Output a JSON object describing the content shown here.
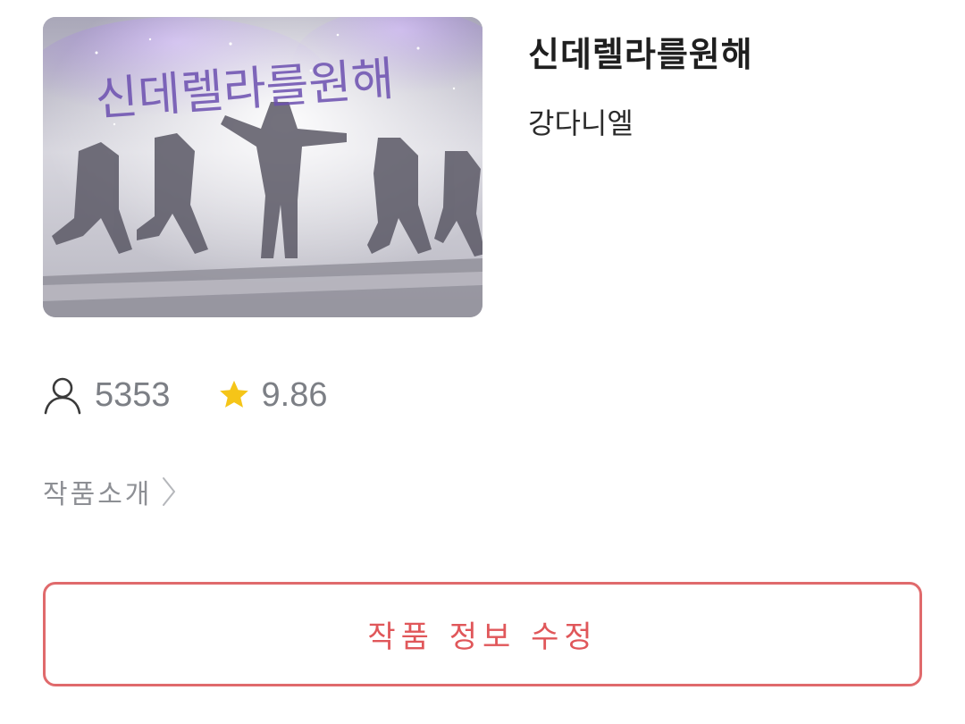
{
  "work": {
    "title": "신데렐라를원해",
    "author": "강다니엘",
    "cover_text": "신데렐라를원해"
  },
  "stats": {
    "views": "5353",
    "rating": "9.86",
    "views_icon": "user-icon",
    "rating_icon": "star-icon"
  },
  "intro": {
    "label": "작품소개",
    "chevron_icon": "chevron-right-icon"
  },
  "actions": {
    "edit_label": "작품 정보 수정"
  },
  "colors": {
    "accent": "#e0575a",
    "star": "#f5c518",
    "muted_text": "#7c7f85"
  }
}
